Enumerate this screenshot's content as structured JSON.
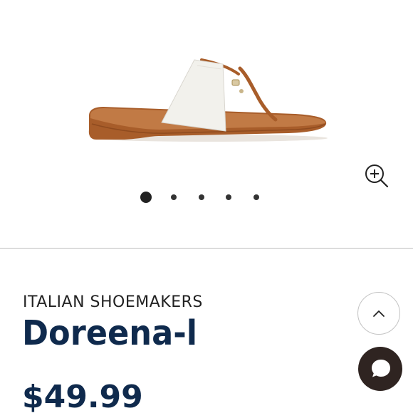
{
  "product": {
    "brand": "ITALIAN SHOEMAKERS",
    "name": "Doreena-l",
    "price": "$49.99"
  },
  "gallery": {
    "image": "sandal-image",
    "slide_count": 5,
    "active_slide": 1
  },
  "icons": {
    "zoom": "zoom-in-icon",
    "scroll_top": "chevron-up-icon",
    "chat": "chat-bubble-icon"
  },
  "colors": {
    "title": "#0f2a4d",
    "chat_button": "#2f2421",
    "strap_leather": "#b0652d",
    "strap_band": "#f2f1ec"
  }
}
